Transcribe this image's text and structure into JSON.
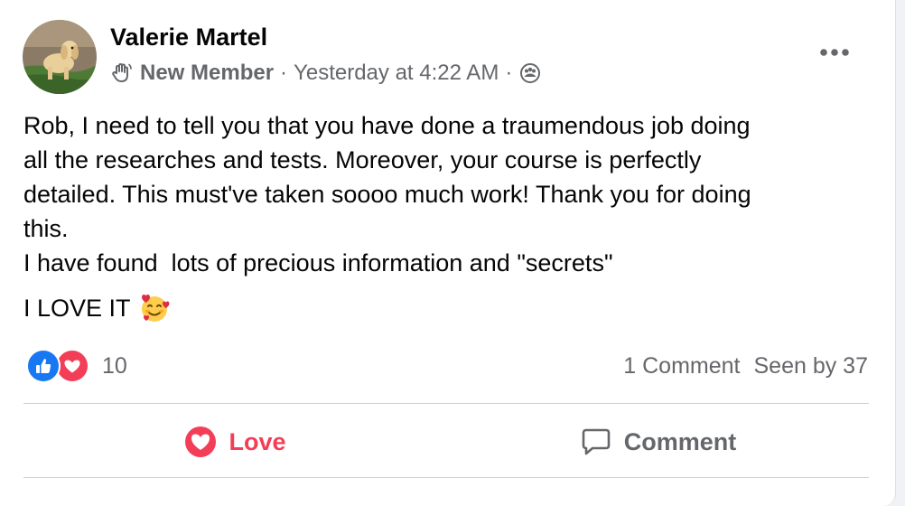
{
  "post": {
    "author": "Valerie Martel",
    "badge": "New Member",
    "separator": "·",
    "timestamp": "Yesterday at 4:22 AM",
    "privacy_icon": "group-privacy-icon",
    "body_paragraph": "Rob, I need to tell you that you have done a traumendous job doing\nall the researches and tests. Moreover, your course is perfectly\ndetailed. This must've taken soooo much work! Thank you for doing\nthis.\nI have found  lots of precious information and \"secrets\"",
    "body_closing": "I LOVE IT",
    "closing_emoji": "smiling-face-with-hearts"
  },
  "reactions": {
    "count": "10",
    "types": [
      "like",
      "love"
    ]
  },
  "stats": {
    "comments": "1 Comment",
    "seen": "Seen by 37"
  },
  "actions": {
    "love_label": "Love",
    "comment_label": "Comment"
  },
  "colors": {
    "love": "#f33e58",
    "like": "#1877f2",
    "secondary_text": "#65676b",
    "primary_text": "#050505"
  }
}
